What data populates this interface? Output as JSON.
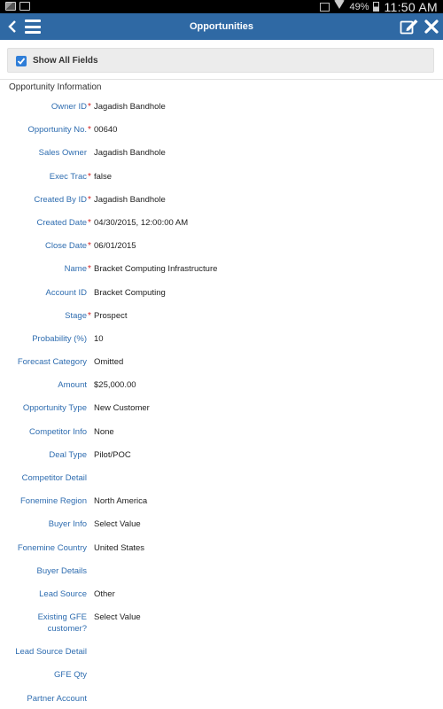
{
  "status_bar": {
    "battery": "49%",
    "time": "11:50 AM"
  },
  "header": {
    "title": "Opportunities",
    "icons": {
      "back": "chevron-left-icon",
      "menu": "hamburger-menu-icon",
      "edit": "edit-icon",
      "close": "close-icon"
    }
  },
  "toggle": {
    "label": "Show All Fields",
    "checked": true
  },
  "section": {
    "title": "Opportunity Information"
  },
  "fields": [
    {
      "label": "Owner ID",
      "required": true,
      "value": "Jagadish Bandhole"
    },
    {
      "label": "Opportunity No.",
      "required": true,
      "value": "00640"
    },
    {
      "label": "Sales Owner",
      "required": false,
      "value": "Jagadish Bandhole"
    },
    {
      "label": "Exec Trac",
      "required": true,
      "value": "false"
    },
    {
      "label": "Created By ID",
      "required": true,
      "value": "Jagadish Bandhole"
    },
    {
      "label": "Created Date",
      "required": true,
      "value": "04/30/2015, 12:00:00 AM"
    },
    {
      "label": "Close Date",
      "required": true,
      "value": "06/01/2015"
    },
    {
      "label": "Name",
      "required": true,
      "value": "Bracket Computing Infrastructure"
    },
    {
      "label": "Account ID",
      "required": false,
      "value": "Bracket Computing"
    },
    {
      "label": "Stage",
      "required": true,
      "value": "Prospect"
    },
    {
      "label": "Probability (%)",
      "required": false,
      "value": "10"
    },
    {
      "label": "Forecast Category",
      "required": false,
      "value": "Omitted"
    },
    {
      "label": "Amount",
      "required": false,
      "value": "$25,000.00"
    },
    {
      "label": "Opportunity Type",
      "required": false,
      "value": "New Customer"
    },
    {
      "label": "Competitor Info",
      "required": false,
      "value": "None"
    },
    {
      "label": "Deal Type",
      "required": false,
      "value": "Pilot/POC"
    },
    {
      "label": "Competitor Detail",
      "required": false,
      "value": ""
    },
    {
      "label": "Fonemine Region",
      "required": false,
      "value": "North America"
    },
    {
      "label": "Buyer Info",
      "required": false,
      "value": "Select Value"
    },
    {
      "label": "Fonemine Country",
      "required": false,
      "value": "United States"
    },
    {
      "label": "Buyer Details",
      "required": false,
      "value": ""
    },
    {
      "label": "Lead Source",
      "required": false,
      "value": "Other"
    },
    {
      "label": "Existing GFE customer?",
      "required": false,
      "value": "Select Value",
      "tall": true
    },
    {
      "label": "Lead Source Detail",
      "required": false,
      "value": ""
    },
    {
      "label": "GFE Qty",
      "required": false,
      "value": ""
    },
    {
      "label": "Partner Account",
      "required": false,
      "value": ""
    }
  ],
  "colors": {
    "header_bg": "#2f69a4",
    "label_blue": "#2f6db0",
    "required_red": "#d21f1f",
    "checkbox_blue": "#2f7ed8"
  }
}
